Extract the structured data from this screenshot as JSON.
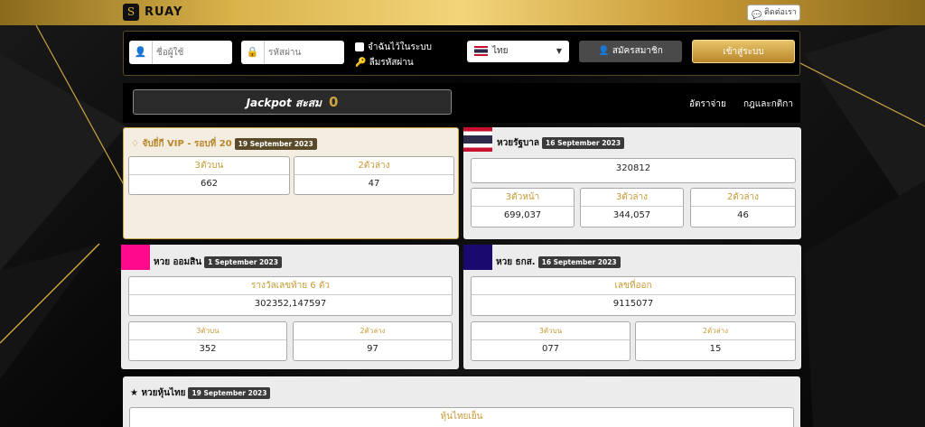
{
  "header": {
    "brand": "RUAY",
    "logo_letter": "S",
    "contact_label": "ติดต่อเรา"
  },
  "login": {
    "username_placeholder": "ชื่อผู้ใช้",
    "password_placeholder": "รหัสผ่าน",
    "remember_label": "จำฉันไว้ในระบบ",
    "forgot_label": "ลืมรหัสผ่าน",
    "language": "ไทย",
    "register_label": "สมัครสมาชิก",
    "login_label": "เข้าสู่ระบบ"
  },
  "jackpot": {
    "label": "Jackpot สะสม",
    "value": "0"
  },
  "nav": {
    "rates": "อัตราจ่าย",
    "rules": "กฎและกติกา"
  },
  "cards": {
    "vip": {
      "title": "จับยี่กี VIP - รอบที่ 20",
      "date": "19 September 2023",
      "c1_label": "3ตัวบน",
      "c1_value": "662",
      "c2_label": "2ตัวล่าง",
      "c2_value": "47"
    },
    "gov": {
      "title": "หวยรัฐบาล",
      "date": "16 September 2023",
      "first": "320812",
      "c1_label": "3ตัวหน้า",
      "c1_value": "699,037",
      "c2_label": "3ตัวล่าง",
      "c2_value": "344,057",
      "c3_label": "2ตัวล่าง",
      "c3_value": "46"
    },
    "gsb": {
      "title": "หวย ออมสิน",
      "date": "1 September 2023",
      "main_label": "รางวัลเลขท้าย 6 ตัว",
      "main_value": "302352,147597",
      "c1_label": "3ตัวบน",
      "c1_value": "352",
      "c2_label": "2ตัวล่าง",
      "c2_value": "97",
      "color": "#ff0a8c"
    },
    "baac": {
      "title": "หวย ธกส.",
      "date": "16 September 2023",
      "main_label": "เลขที่ออก",
      "main_value": "9115077",
      "c1_label": "3ตัวบน",
      "c1_value": "077",
      "c2_label": "2ตัวล่าง",
      "c2_value": "15",
      "color": "#1a0a6e"
    },
    "stock": {
      "title": "หวยหุ้นไทย",
      "date": "19 September 2023",
      "main_label": "หุ้นไทยเย็น"
    }
  },
  "colors": {
    "gold": "#c99a35",
    "accent_bar": "#d9b24a"
  }
}
